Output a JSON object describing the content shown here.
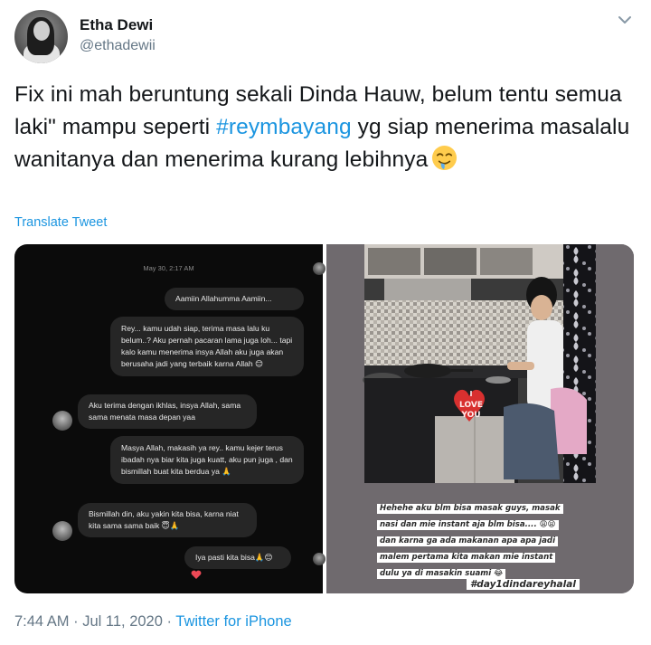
{
  "author": {
    "name": "Etha Dewi",
    "handle": "@ethadewii"
  },
  "tweet": {
    "text_before": "Fix ini mah beruntung sekali Dinda Hauw, belum tentu semua laki\" mampu seperti ",
    "hashtag": "#reymbayang",
    "text_after": " yg siap menerima masalalu wanitanya dan menerima kurang lebihnya",
    "emoji": "drooling-face-emoji",
    "translate_label": "Translate Tweet"
  },
  "chat": {
    "date": "May 30, 2:17 AM",
    "messages": [
      {
        "side": "right",
        "text": "Aamiin Allahumma Aamiin..."
      },
      {
        "side": "right",
        "text": "Rey... kamu udah siap, terima masa lalu ku belum..? Aku pernah pacaran lama juga loh... tapi kalo kamu menerima insya Allah aku juga akan berusaha jadi yang terbaik karna Allah 😊"
      },
      {
        "side": "left",
        "text": "Aku terima dengan ikhlas, insya Allah, sama sama menata masa depan yaa"
      },
      {
        "side": "right",
        "text": "Masya Allah, makasih ya rey.. kamu kejer terus ibadah nya biar kita juga kuatt, aku pun juga , dan bismillah buat kita berdua ya 🙏"
      },
      {
        "side": "left",
        "text": "Bismillah din, aku yakin kita bisa, karna niat kita sama sama baik 😇🙏"
      },
      {
        "side": "right",
        "text": "Iya pasti kita bisa🙏😊"
      }
    ]
  },
  "story": {
    "sticker_text": [
      "I",
      "LOVE",
      "YOU"
    ],
    "caption_lines": [
      "Hehehe aku blm bisa masak guys, masak",
      "nasi dan mie instant aja blm bisa.... 😩😫",
      "dan karna ga ada makanan apa apa jadi",
      "malem pertama kita makan mie instant",
      "dulu ya di masakin suami 😂"
    ],
    "hashtag": "#day1dindareyhalal"
  },
  "footer": {
    "time": "7:44 AM",
    "separator": " · ",
    "date": "Jul 11, 2020",
    "source": "Twitter for iPhone"
  },
  "colors": {
    "link": "#1b95e0",
    "secondary": "#657786",
    "text": "#14171a",
    "chat_bg": "#0b0b0b",
    "bubble_bg": "#262626"
  }
}
